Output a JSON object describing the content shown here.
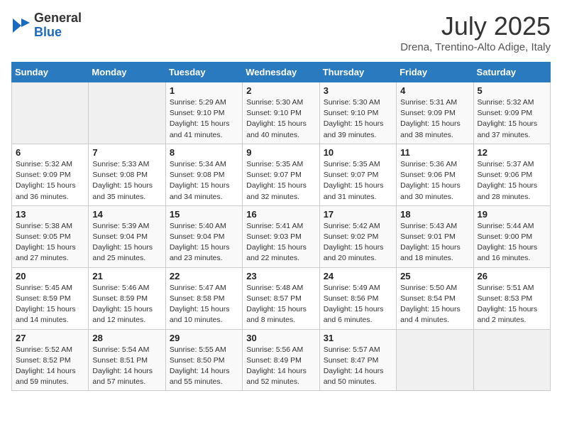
{
  "header": {
    "logo_general": "General",
    "logo_blue": "Blue",
    "title": "July 2025",
    "subtitle": "Drena, Trentino-Alto Adige, Italy"
  },
  "weekdays": [
    "Sunday",
    "Monday",
    "Tuesday",
    "Wednesday",
    "Thursday",
    "Friday",
    "Saturday"
  ],
  "weeks": [
    [
      {
        "day": "",
        "info": ""
      },
      {
        "day": "",
        "info": ""
      },
      {
        "day": "1",
        "info": "Sunrise: 5:29 AM\nSunset: 9:10 PM\nDaylight: 15 hours and 41 minutes."
      },
      {
        "day": "2",
        "info": "Sunrise: 5:30 AM\nSunset: 9:10 PM\nDaylight: 15 hours and 40 minutes."
      },
      {
        "day": "3",
        "info": "Sunrise: 5:30 AM\nSunset: 9:10 PM\nDaylight: 15 hours and 39 minutes."
      },
      {
        "day": "4",
        "info": "Sunrise: 5:31 AM\nSunset: 9:09 PM\nDaylight: 15 hours and 38 minutes."
      },
      {
        "day": "5",
        "info": "Sunrise: 5:32 AM\nSunset: 9:09 PM\nDaylight: 15 hours and 37 minutes."
      }
    ],
    [
      {
        "day": "6",
        "info": "Sunrise: 5:32 AM\nSunset: 9:09 PM\nDaylight: 15 hours and 36 minutes."
      },
      {
        "day": "7",
        "info": "Sunrise: 5:33 AM\nSunset: 9:08 PM\nDaylight: 15 hours and 35 minutes."
      },
      {
        "day": "8",
        "info": "Sunrise: 5:34 AM\nSunset: 9:08 PM\nDaylight: 15 hours and 34 minutes."
      },
      {
        "day": "9",
        "info": "Sunrise: 5:35 AM\nSunset: 9:07 PM\nDaylight: 15 hours and 32 minutes."
      },
      {
        "day": "10",
        "info": "Sunrise: 5:35 AM\nSunset: 9:07 PM\nDaylight: 15 hours and 31 minutes."
      },
      {
        "day": "11",
        "info": "Sunrise: 5:36 AM\nSunset: 9:06 PM\nDaylight: 15 hours and 30 minutes."
      },
      {
        "day": "12",
        "info": "Sunrise: 5:37 AM\nSunset: 9:06 PM\nDaylight: 15 hours and 28 minutes."
      }
    ],
    [
      {
        "day": "13",
        "info": "Sunrise: 5:38 AM\nSunset: 9:05 PM\nDaylight: 15 hours and 27 minutes."
      },
      {
        "day": "14",
        "info": "Sunrise: 5:39 AM\nSunset: 9:04 PM\nDaylight: 15 hours and 25 minutes."
      },
      {
        "day": "15",
        "info": "Sunrise: 5:40 AM\nSunset: 9:04 PM\nDaylight: 15 hours and 23 minutes."
      },
      {
        "day": "16",
        "info": "Sunrise: 5:41 AM\nSunset: 9:03 PM\nDaylight: 15 hours and 22 minutes."
      },
      {
        "day": "17",
        "info": "Sunrise: 5:42 AM\nSunset: 9:02 PM\nDaylight: 15 hours and 20 minutes."
      },
      {
        "day": "18",
        "info": "Sunrise: 5:43 AM\nSunset: 9:01 PM\nDaylight: 15 hours and 18 minutes."
      },
      {
        "day": "19",
        "info": "Sunrise: 5:44 AM\nSunset: 9:00 PM\nDaylight: 15 hours and 16 minutes."
      }
    ],
    [
      {
        "day": "20",
        "info": "Sunrise: 5:45 AM\nSunset: 8:59 PM\nDaylight: 15 hours and 14 minutes."
      },
      {
        "day": "21",
        "info": "Sunrise: 5:46 AM\nSunset: 8:59 PM\nDaylight: 15 hours and 12 minutes."
      },
      {
        "day": "22",
        "info": "Sunrise: 5:47 AM\nSunset: 8:58 PM\nDaylight: 15 hours and 10 minutes."
      },
      {
        "day": "23",
        "info": "Sunrise: 5:48 AM\nSunset: 8:57 PM\nDaylight: 15 hours and 8 minutes."
      },
      {
        "day": "24",
        "info": "Sunrise: 5:49 AM\nSunset: 8:56 PM\nDaylight: 15 hours and 6 minutes."
      },
      {
        "day": "25",
        "info": "Sunrise: 5:50 AM\nSunset: 8:54 PM\nDaylight: 15 hours and 4 minutes."
      },
      {
        "day": "26",
        "info": "Sunrise: 5:51 AM\nSunset: 8:53 PM\nDaylight: 15 hours and 2 minutes."
      }
    ],
    [
      {
        "day": "27",
        "info": "Sunrise: 5:52 AM\nSunset: 8:52 PM\nDaylight: 14 hours and 59 minutes."
      },
      {
        "day": "28",
        "info": "Sunrise: 5:54 AM\nSunset: 8:51 PM\nDaylight: 14 hours and 57 minutes."
      },
      {
        "day": "29",
        "info": "Sunrise: 5:55 AM\nSunset: 8:50 PM\nDaylight: 14 hours and 55 minutes."
      },
      {
        "day": "30",
        "info": "Sunrise: 5:56 AM\nSunset: 8:49 PM\nDaylight: 14 hours and 52 minutes."
      },
      {
        "day": "31",
        "info": "Sunrise: 5:57 AM\nSunset: 8:47 PM\nDaylight: 14 hours and 50 minutes."
      },
      {
        "day": "",
        "info": ""
      },
      {
        "day": "",
        "info": ""
      }
    ]
  ]
}
